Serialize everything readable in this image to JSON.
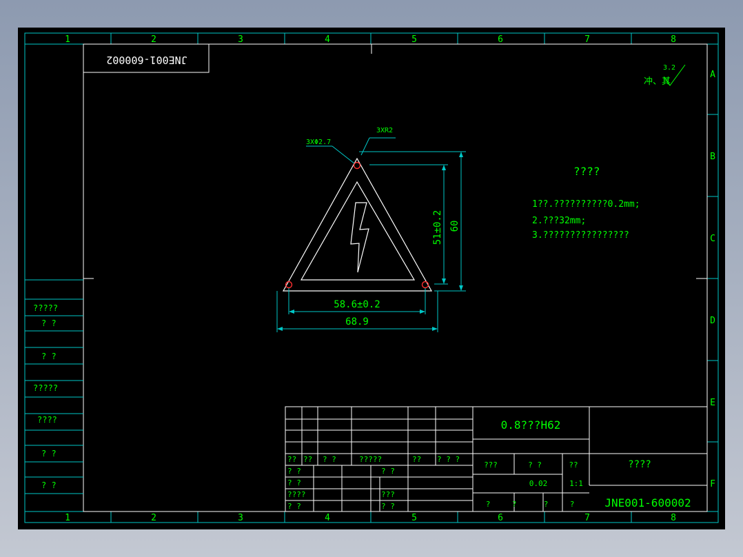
{
  "colors": {
    "background": "#000000",
    "frame": "#00c8c8",
    "text_green": "#00ff00",
    "geometry": "#ffffff",
    "dimension": "#00c8c8",
    "hole": "#ff3030"
  },
  "zone_columns": [
    "1",
    "2",
    "3",
    "4",
    "5",
    "6",
    "7",
    "8"
  ],
  "zone_rows": [
    "A",
    "B",
    "C",
    "D",
    "E",
    "F"
  ],
  "mirrored_code": "JNE001-600002",
  "surface_finish": {
    "value": "3.2",
    "prefix": "冲、其"
  },
  "annotations": {
    "holes": "3XΦ2.7",
    "corner_radius": "3XR2"
  },
  "dimensions": {
    "height_outer": "60",
    "height_inner": "51±0.2",
    "width_inner": "58.6±0.2",
    "width_outer": "68.9"
  },
  "notes": {
    "title": "????",
    "lines": [
      "1??.??????????0.2mm;",
      "2.???32mm;",
      "3.????????????????"
    ]
  },
  "left_column": [
    "?????",
    "? ?",
    "? ?",
    "?????",
    "????",
    "? ?",
    "? ?"
  ],
  "title_block": {
    "material": "0.8???H62",
    "part_name": "????",
    "drawing_number": "JNE001-600002",
    "header_row": [
      "??",
      "??",
      "? ?",
      "?????",
      "??",
      "? ? ?"
    ],
    "sign_rows": [
      [
        "? ?",
        "? ?"
      ],
      [
        "? ?",
        ""
      ],
      [
        "????",
        "???"
      ],
      [
        "? ?",
        "? ?"
      ]
    ],
    "labels": {
      "stage": "???",
      "weight": "? ?",
      "scale": "??"
    },
    "values": {
      "weight": "0.02",
      "scale": "1:1"
    },
    "bottom_row": [
      "?",
      "?",
      "?",
      "?"
    ]
  }
}
